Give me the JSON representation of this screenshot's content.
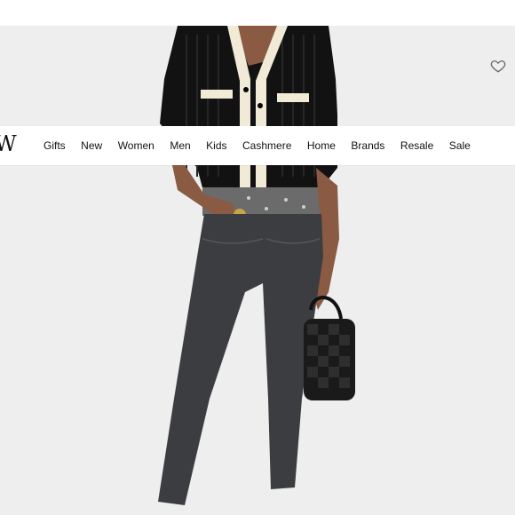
{
  "brand": {
    "logo_text": "W"
  },
  "nav": {
    "items": [
      {
        "label": "Gifts"
      },
      {
        "label": "New"
      },
      {
        "label": "Women"
      },
      {
        "label": "Men"
      },
      {
        "label": "Kids"
      },
      {
        "label": "Cashmere"
      },
      {
        "label": "Home"
      },
      {
        "label": "Brands"
      },
      {
        "label": "Resale"
      },
      {
        "label": "Sale"
      }
    ]
  },
  "product": {
    "favorite_icon": "heart-icon"
  },
  "colors": {
    "photo_bg": "#eeeeee",
    "sweater": "#111111",
    "trim": "#f1ead6",
    "jeans": "#3c3d40",
    "bag": "#1a1a1a"
  }
}
